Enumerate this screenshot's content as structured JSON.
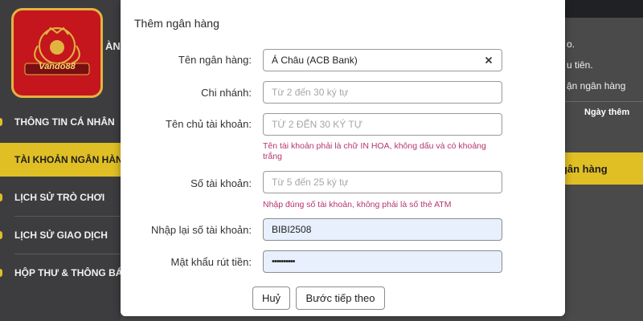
{
  "background": {
    "sidebar": {
      "logo_text": "Vando88",
      "fragment_text": "ÀN",
      "items": [
        {
          "label": "THÔNG TIN CÁ NHÂN"
        },
        {
          "label": "TÀI KHOẢN NGÂN HÀNG",
          "active": true
        },
        {
          "label": "LỊCH SỬ TRÒ CHƠI"
        },
        {
          "label": "LỊCH SỬ GIAO DỊCH"
        },
        {
          "label": "HỘP THƯ & THÔNG BÁO"
        }
      ]
    },
    "right_panel": {
      "line1": "o.",
      "line2": "u tiên.",
      "line3": "ận ngân hàng",
      "column_header": "Ngày thêm",
      "add_button": "ngân hàng"
    }
  },
  "modal": {
    "title": "Thêm ngân hàng",
    "fields": [
      {
        "label": "Tên ngân hàng:",
        "value": "Á Châu (ACB Bank)",
        "placeholder": ""
      },
      {
        "label": "Chi nhánh:",
        "value": "",
        "placeholder": "Từ 2 đến 30 ký tự"
      },
      {
        "label": "Tên chủ tài khoản:",
        "value": "",
        "placeholder": "TỪ 2 ĐẾN 30 KÝ TỰ",
        "hint": "Tên tài khoản phải là chữ IN HOA, không dấu và có khoảng trắng"
      },
      {
        "label": "Số tài khoản:",
        "value": "",
        "placeholder": "Từ 5 đến 25 ký tự",
        "hint": "Nhập đúng số tài khoản, không phải là số thẻ ATM"
      },
      {
        "label": "Nhập lại số tài khoản:",
        "value": "BIBI2508",
        "placeholder": ""
      },
      {
        "label": "Mật khẩu rút tiền:",
        "value": "••••••••••",
        "placeholder": ""
      }
    ],
    "buttons": {
      "cancel": "Huỷ",
      "next": "Bước tiếp theo"
    }
  },
  "colors": {
    "accent_yellow": "#e0bf25",
    "hint_pink": "#b5356d",
    "autofill_blue": "#e8f0fe"
  }
}
